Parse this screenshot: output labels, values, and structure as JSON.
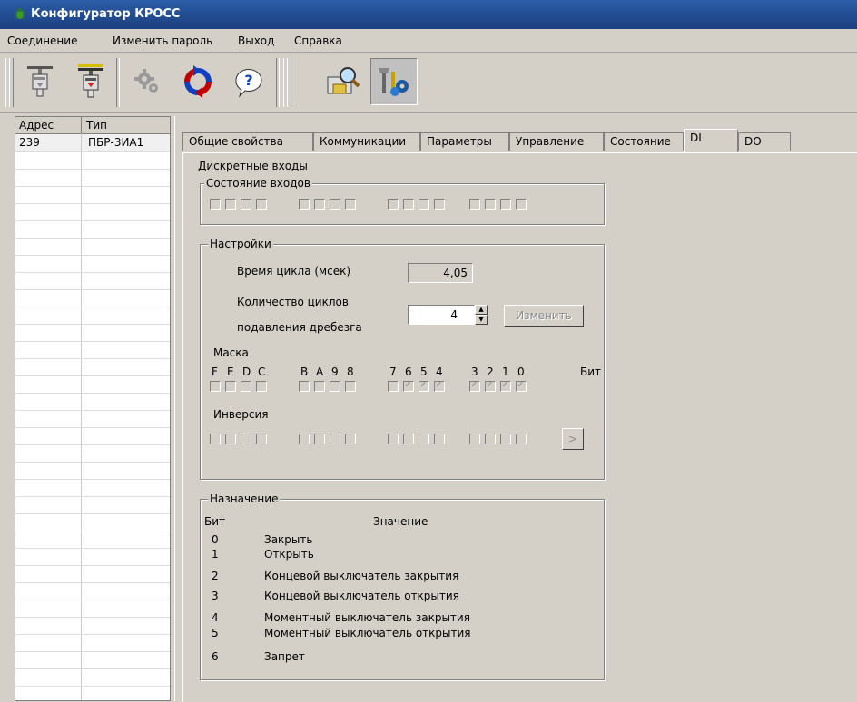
{
  "window": {
    "title": "Конфигуратор КРОСС"
  },
  "menu": [
    "Соединение",
    "Изменить пароль",
    "Выход",
    "Справка"
  ],
  "toolbar": [
    "disconnect-device-icon",
    "connect-device-icon",
    "settings-gear-icon",
    "refresh-icon",
    "help-icon",
    "search-device-icon",
    "configure-tools-icon"
  ],
  "devices": {
    "headers": [
      "Адрес",
      "Тип"
    ],
    "rows": [
      {
        "address": "239",
        "type": "ПБР-3ИА1"
      }
    ]
  },
  "tabs": [
    "Общие свойства",
    "Коммуникации",
    "Параметры",
    "Управление",
    "Состояние",
    "DI",
    "DO"
  ],
  "active_tab": "DI",
  "di": {
    "title": "Дискретные входы",
    "inputs_state_label": "Состояние входов",
    "settings_label": "Настройки",
    "cycle_time_label": "Время цикла (мсек)",
    "cycle_time_value": "4,05",
    "debounce_label_1": "Количество циклов",
    "debounce_label_2": "подавления дребезга",
    "debounce_value": "4",
    "change_button": "Изменить",
    "mask_label": "Маска",
    "bit_names": [
      "F",
      "E",
      "D",
      "C",
      "B",
      "A",
      "9",
      "8",
      "7",
      "6",
      "5",
      "4",
      "3",
      "2",
      "1",
      "0"
    ],
    "bit_word": "Бит",
    "mask_checked": [
      false,
      false,
      false,
      false,
      false,
      false,
      false,
      false,
      false,
      true,
      true,
      true,
      true,
      true,
      true,
      true
    ],
    "inversion_label": "Инверсия",
    "inversion_button": ">",
    "assign_label": "Назначение",
    "assign_col_bit": "Бит",
    "assign_col_value": "Значение",
    "assignments": [
      {
        "bit": "0",
        "value": "Закрыть"
      },
      {
        "bit": "1",
        "value": "Открыть"
      },
      {
        "bit": "2",
        "value": "Концевой выключатель закрытия"
      },
      {
        "bit": "3",
        "value": "Концевой выключатель открытия"
      },
      {
        "bit": "4",
        "value": "Моментный выключатель закрытия"
      },
      {
        "bit": "5",
        "value": "Моментный выключатель открытия"
      },
      {
        "bit": "6",
        "value": "Запрет"
      }
    ]
  }
}
